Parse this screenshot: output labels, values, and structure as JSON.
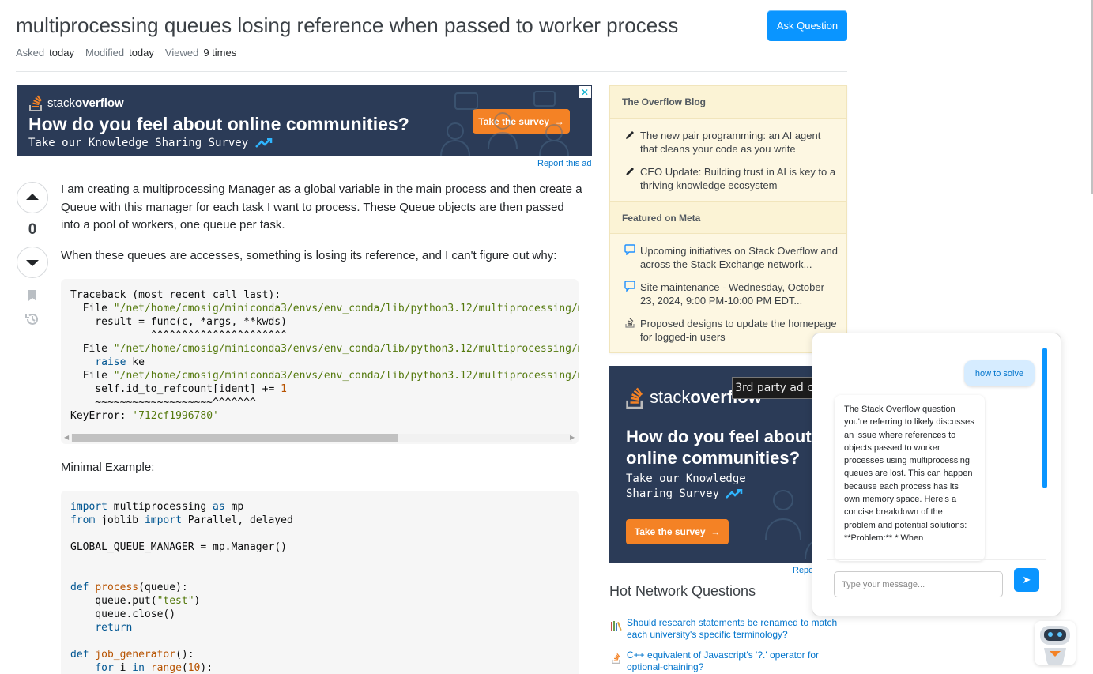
{
  "question": {
    "title": "multiprocessing queues losing reference when passed to worker process",
    "asked_label": "Asked",
    "asked_value": "today",
    "modified_label": "Modified",
    "modified_value": "today",
    "viewed_label": "Viewed",
    "viewed_value": "9 times",
    "vote_count": "0",
    "para1": "I am creating a multiprocessing Manager as a global variable in the main process and then create a Queue with this manager for each task I want to process. These Queue objects are then passed into a pool of workers, one queue per task.",
    "para2": "When these queues are accesses, something is losing its reference, and I can't figure out why:",
    "para3": "Minimal Example:"
  },
  "header": {
    "ask_button": "Ask Question"
  },
  "ads": {
    "top": {
      "logo_text_1": "stack",
      "logo_text_2": "overflow",
      "headline": "How do you feel about online communities?",
      "sub": "Take our Knowledge Sharing Survey",
      "cta": "Take the survey",
      "report": "Report this ad"
    },
    "side": {
      "logo_text_1": "stack",
      "logo_text_2": "overflow",
      "headline": "How do you feel about online communities?",
      "sub": "Take our Knowledge Sharing Survey",
      "cta": "Take the survey",
      "report": "Repo",
      "tooltip": "3rd party ad content"
    }
  },
  "sidebar": {
    "blog_title": "The Overflow Blog",
    "blog_items": [
      "The new pair programming: an AI agent that cleans your code as you write",
      "CEO Update: Building trust in AI is key to a thriving knowledge ecosystem"
    ],
    "meta_title": "Featured on Meta",
    "meta_items": [
      "Upcoming initiatives on Stack Overflow and across the Stack Exchange network...",
      "Site maintenance - Wednesday, October 23, 2024, 9:00 PM-10:00 PM EDT...",
      "Proposed designs to update the homepage for logged-in users"
    ],
    "hnq_title": "Hot Network Questions",
    "hnq_items": [
      "Should research statements be renamed to match each university's specific terminology?",
      "C++ equivalent of Javascript's '?.' operator for optional-chaining?"
    ]
  },
  "chat": {
    "user_message": "how to solve",
    "bot_message": "The Stack Overflow question you're referring to likely discusses an issue where references to objects passed to worker processes using multiprocessing queues are lost. This can happen because each process has its own memory space. Here's a concise breakdown of the problem and potential solutions: **Problem:** * When",
    "input_placeholder": "Type your message...",
    "send_icon": "➤"
  },
  "icons": {
    "upvote": "upvote-icon",
    "downvote": "downvote-icon",
    "bookmark": "bookmark-icon",
    "history": "history-icon",
    "pencil": "pencil-icon",
    "speech": "speech-bubble-icon",
    "stack": "stack-exchange-icon"
  },
  "colors": {
    "accent": "#0a95ff",
    "ad_bg": "#2b3b57",
    "ad_orange": "#f48225",
    "sidebar_bg": "#fbf3d5"
  }
}
